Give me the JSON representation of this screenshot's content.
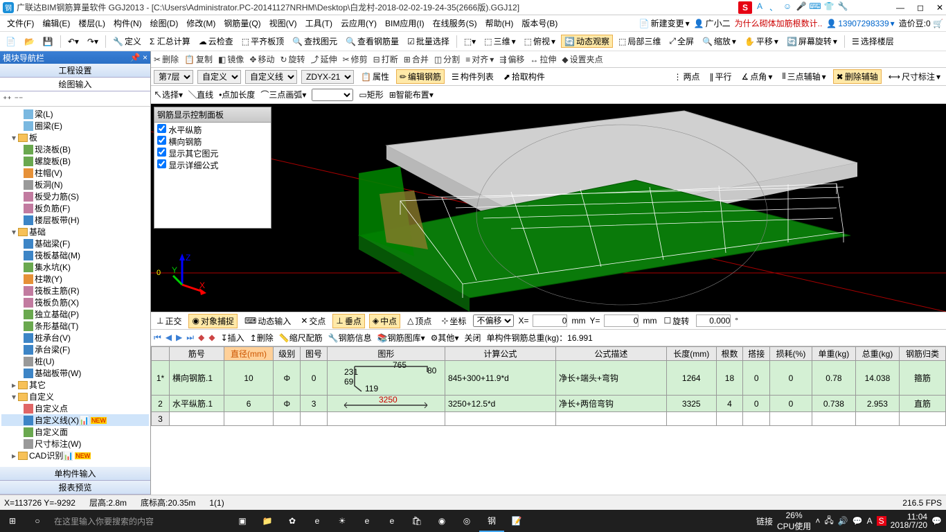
{
  "title": "广联达BIM钢筋算量软件 GGJ2013 - [C:\\Users\\Administrator.PC-20141127NRHM\\Desktop\\白龙村-2018-02-02-19-24-35(2666版).GGJ12]",
  "menus": [
    "文件(F)",
    "编辑(E)",
    "楼层(L)",
    "构件(N)",
    "绘图(D)",
    "修改(M)",
    "钢筋量(Q)",
    "视图(V)",
    "工具(T)",
    "云应用(Y)",
    "BIM应用(I)",
    "在线服务(S)",
    "帮助(H)",
    "版本号(B)"
  ],
  "menu_right": {
    "new_change": "新建变更",
    "user": "广小二",
    "notice": "为什么砌体加筋根数计..",
    "phone": "13907298339",
    "credit_label": "造价豆:",
    "credit": "0"
  },
  "toolbar1": {
    "define": "定义",
    "sum": "Σ 汇总计算",
    "cloud": "云检查",
    "flat": "平齐板顶",
    "find": "查找图元",
    "rebar": "查看钢筋量",
    "batch": "批量选择",
    "dim3": "三维",
    "front": "俯视",
    "dyn": "动态观察",
    "local": "局部三维",
    "full": "全屏",
    "zoom": "缩放",
    "pan": "平移",
    "rot": "屏幕旋转",
    "floor": "选择楼层"
  },
  "nav": {
    "title": "模块导航栏",
    "tab1": "工程设置",
    "tab2": "绘图输入",
    "bottom1": "单构件输入",
    "bottom2": "报表预览"
  },
  "tree": {
    "beam": "梁(L)",
    "ring": "圈梁(E)",
    "board": "板",
    "cast": "现浇板(B)",
    "spiral": "螺旋板(B)",
    "cap": "柱帽(V)",
    "hole": "板洞(N)",
    "force": "板受力筋(S)",
    "neg": "板负筋(F)",
    "band": "楼层板带(H)",
    "found": "基础",
    "fb": "基础梁(F)",
    "raft": "筏板基础(M)",
    "pit": "集水坑(K)",
    "pier": "柱墩(Y)",
    "rmain": "筏板主筋(R)",
    "rneg": "筏板负筋(X)",
    "iso": "独立基础(P)",
    "strip": "条形基础(T)",
    "pcap": "桩承台(V)",
    "cbeam": "承台梁(F)",
    "pile": "桩(U)",
    "fband": "基础板带(W)",
    "other": "其它",
    "custom": "自定义",
    "cpoint": "自定义点",
    "cline": "自定义线(X)",
    "cface": "自定义面",
    "dim": "尺寸标注(W)",
    "cad": "CAD识别"
  },
  "edit_ops": {
    "del": "删除",
    "copy": "复制",
    "mirror": "镜像",
    "move": "移动",
    "rotate": "旋转",
    "extend": "延伸",
    "trim": "修剪",
    "break": "打断",
    "merge": "合并",
    "split": "分割",
    "align": "对齐",
    "offset": "偏移",
    "stretch": "拉伸",
    "grip": "设置夹点"
  },
  "selbar": {
    "floor": "第7层",
    "cat": "自定义",
    "type": "自定义线",
    "code": "ZDYX-21",
    "prop": "属性",
    "edit": "编辑钢筋",
    "list": "构件列表",
    "pick": "拾取构件",
    "twopt": "两点",
    "parallel": "平行",
    "ptang": "点角",
    "threeaux": "三点辅轴",
    "delax": "删除辅轴",
    "dimlabel": "尺寸标注"
  },
  "drawbar": {
    "select": "选择",
    "line": "直线",
    "ptlen": "点加长度",
    "arc3": "三点画弧",
    "rect": "矩形",
    "smart": "智能布置"
  },
  "float_panel": {
    "title": "钢筋显示控制面板",
    "c1": "水平纵筋",
    "c2": "横向钢筋",
    "c3": "显示其它图元",
    "c4": "显示详细公式"
  },
  "snap": {
    "ortho": "正交",
    "obj": "对象捕捉",
    "dyn": "动态输入",
    "cross": "交点",
    "perp": "垂点",
    "mid": "中点",
    "apex": "顶点",
    "sit": "坐标",
    "nooff": "不偏移",
    "xlabel": "X=",
    "xval": "0",
    "xunit": "mm",
    "ylabel": "Y=",
    "yval": "0",
    "yunit": "mm",
    "rot": "旋转",
    "ang": "0.000",
    "deg": "°"
  },
  "recbar": {
    "insert": "插入",
    "delete": "删除",
    "scale": "缩尺配筋",
    "info": "钢筋信息",
    "lib": "钢筋图库",
    "other": "其他",
    "close": "关闭",
    "total_label": "单构件钢筋总重(kg)：",
    "total": "16.991"
  },
  "grid": {
    "headers": [
      "筋号",
      "直径(mm)",
      "级别",
      "图号",
      "图形",
      "计算公式",
      "公式描述",
      "长度(mm)",
      "根数",
      "搭接",
      "损耗(%)",
      "单重(kg)",
      "总重(kg)",
      "钢筋归类"
    ],
    "rows": [
      {
        "n": "1*",
        "name": "横向钢筋.1",
        "dia": "10",
        "grade": "Φ",
        "code": "0",
        "shape_top": "765",
        "shape_side": "231\n69",
        "shape_diag": "119",
        "shape_r": "80",
        "formula": "845+300+11.9*d",
        "desc": "净长+端头+弯钩",
        "len": "1264",
        "cnt": "18",
        "lap": "0",
        "loss": "0",
        "uw": "0.78",
        "tw": "14.038",
        "cls": "箍筋"
      },
      {
        "n": "2",
        "name": "水平纵筋.1",
        "dia": "6",
        "grade": "Φ",
        "code": "3",
        "shape_len": "3250",
        "formula": "3250+12.5*d",
        "desc": "净长+两倍弯钩",
        "len": "3325",
        "cnt": "4",
        "lap": "0",
        "loss": "0",
        "uw": "0.738",
        "tw": "2.953",
        "cls": "直筋"
      },
      {
        "n": "3"
      }
    ]
  },
  "status": {
    "coord": "X=113726 Y=-9292",
    "fh": "层高:2.8m",
    "bh": "底标高:20.35m",
    "sel": "1(1)",
    "fps": "216.5 FPS"
  },
  "taskbar": {
    "search": "在这里输入你要搜索的内容",
    "link": "链接",
    "cpu": "26%\nCPU使用",
    "time": "11:04",
    "date": "2018/7/20"
  }
}
